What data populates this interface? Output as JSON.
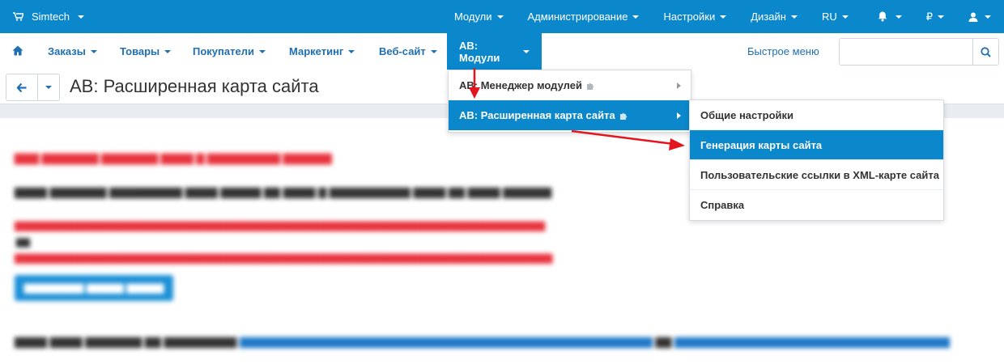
{
  "topbar": {
    "brand": "Simtech",
    "menu": [
      "Модули",
      "Администрирование",
      "Настройки",
      "Дизайн",
      "RU",
      "₽"
    ]
  },
  "nav": {
    "tabs": [
      "Заказы",
      "Товары",
      "Покупатели",
      "Маркетинг",
      "Веб-сайт",
      "AB: Модули"
    ],
    "quick_menu": "Быстрое меню",
    "search_placeholder": ""
  },
  "page": {
    "title": "AB: Расширенная карта сайта"
  },
  "modules_menu": {
    "items": [
      "AB: Менеджер модулей",
      "AB: Расширенная карта сайта"
    ]
  },
  "submenu": {
    "items": [
      "Общие настройки",
      "Генерация карты сайта",
      "Пользовательские ссылки в XML-карте сайта",
      "Справка"
    ]
  },
  "colors": {
    "topbar": "#0b87cc",
    "accent": "#0b87cc",
    "link": "#1f6fb2",
    "annotation": "#e3161f"
  }
}
